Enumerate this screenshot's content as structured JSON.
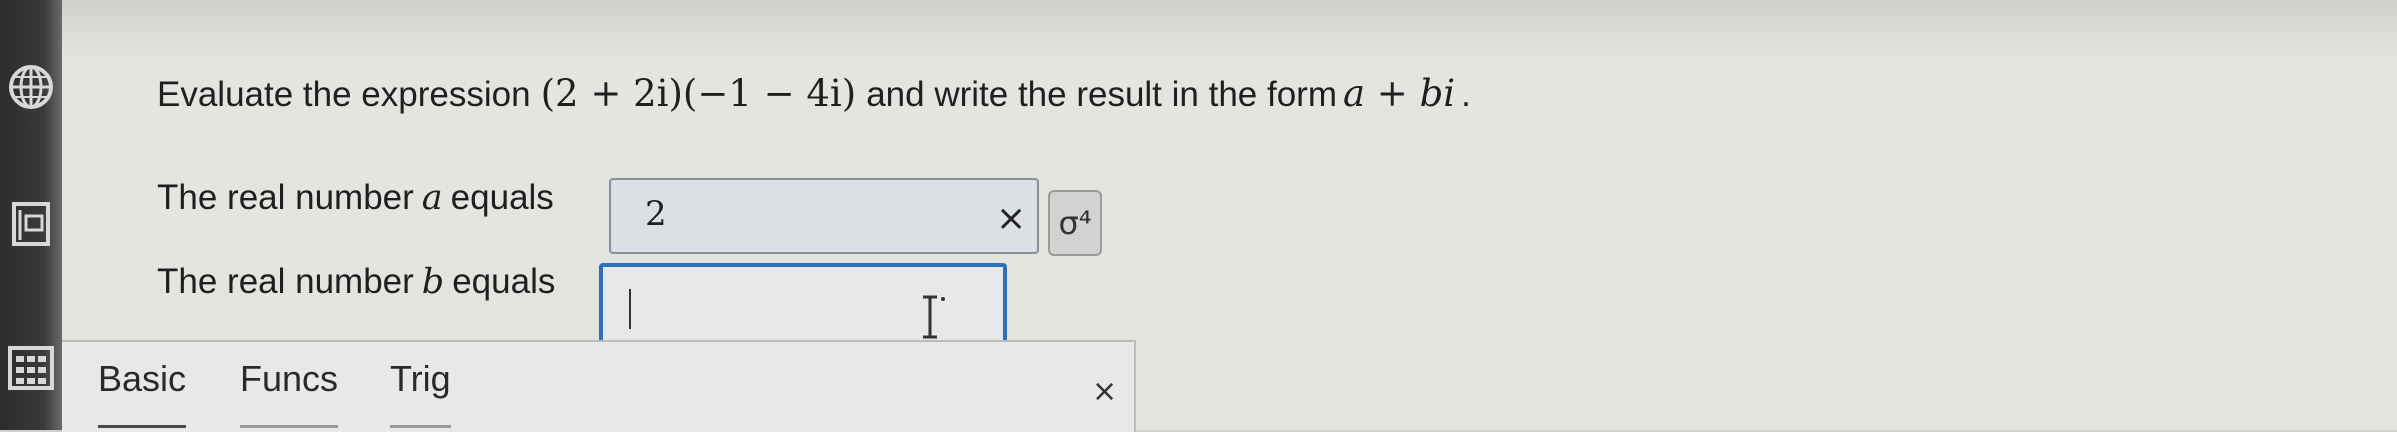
{
  "question": {
    "lead": "Evaluate the expression",
    "expression": "(2 + 2i)(−1 − 4i)",
    "middle": "and write the result in the form",
    "form": "a + bi",
    "end": "."
  },
  "answer_a": {
    "label_prefix": "The real number",
    "variable": "a",
    "label_suffix": "equals",
    "value": "2",
    "clear_symbol": "×",
    "wizard_symbol": "σ⁴"
  },
  "answer_b": {
    "label_prefix": "The real number",
    "variable": "b",
    "label_suffix": "equals",
    "value": ""
  },
  "palette": {
    "tabs": [
      "Basic",
      "Funcs",
      "Trig"
    ],
    "close_symbol": "×"
  },
  "rail_icons": [
    "globe-icon",
    "book-icon",
    "calculator-icon"
  ]
}
